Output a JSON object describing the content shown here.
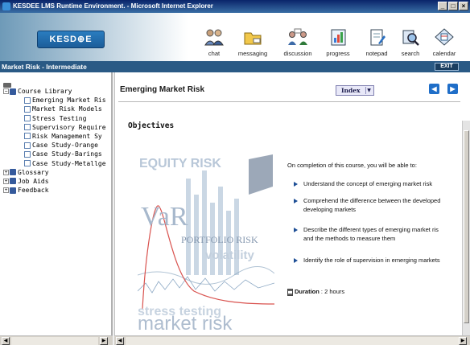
{
  "window": {
    "title": "KESDEE LMS Runtime Environment. - Microsoft Internet Explorer",
    "controls": [
      "_",
      "□",
      "×"
    ]
  },
  "header": {
    "logo": "KESD⊕E",
    "tools": [
      {
        "icon": "chat-icon",
        "label": "chat"
      },
      {
        "icon": "messaging-icon",
        "label": "messaging"
      },
      {
        "icon": "discussion-icon",
        "label": "discussion"
      },
      {
        "icon": "progress-icon",
        "label": "progress"
      },
      {
        "icon": "notepad-icon",
        "label": "notepad"
      },
      {
        "icon": "search-icon",
        "label": "search"
      },
      {
        "icon": "calendar-icon",
        "label": "calendar"
      }
    ]
  },
  "subheader": {
    "title": "Market Risk - Intermediate",
    "exit": "EXIT"
  },
  "tree": {
    "root": "Course Library",
    "items": [
      "Emerging Market Ris",
      "Market Risk Models",
      "Stress Testing",
      "Supervisory Require",
      "Risk Management Sy",
      "Case Study-Orange",
      "Case Study-Barings",
      "Case Study-Metallge"
    ],
    "folders": [
      "Glossary",
      "Job Aids",
      "Feedback"
    ]
  },
  "content": {
    "breadcrumb": "Emerging Market Risk",
    "index_label": "Index",
    "heading": "Objectives",
    "intro": "On completion of this course, you will be able to:",
    "objectives": [
      [
        "Understand the concept of emerging market risk"
      ],
      [
        "Comprehend the difference between the developed",
        "developing markets"
      ],
      [
        "Describe the different types of emerging market ris",
        "and the methods to measure them"
      ],
      [
        "Identify the role of supervision in emerging markets"
      ]
    ],
    "duration_label": "Duration",
    "duration_value": " : 2 hours",
    "illustration_words": [
      "EQUITY RISK",
      "VaR",
      "PORTFOLIO RISK",
      "volatility",
      "stress testing",
      "market risk"
    ]
  },
  "colors": {
    "titlebar": "#0a246a",
    "subheader": "#2a5a85",
    "accent": "#1e4f96"
  }
}
